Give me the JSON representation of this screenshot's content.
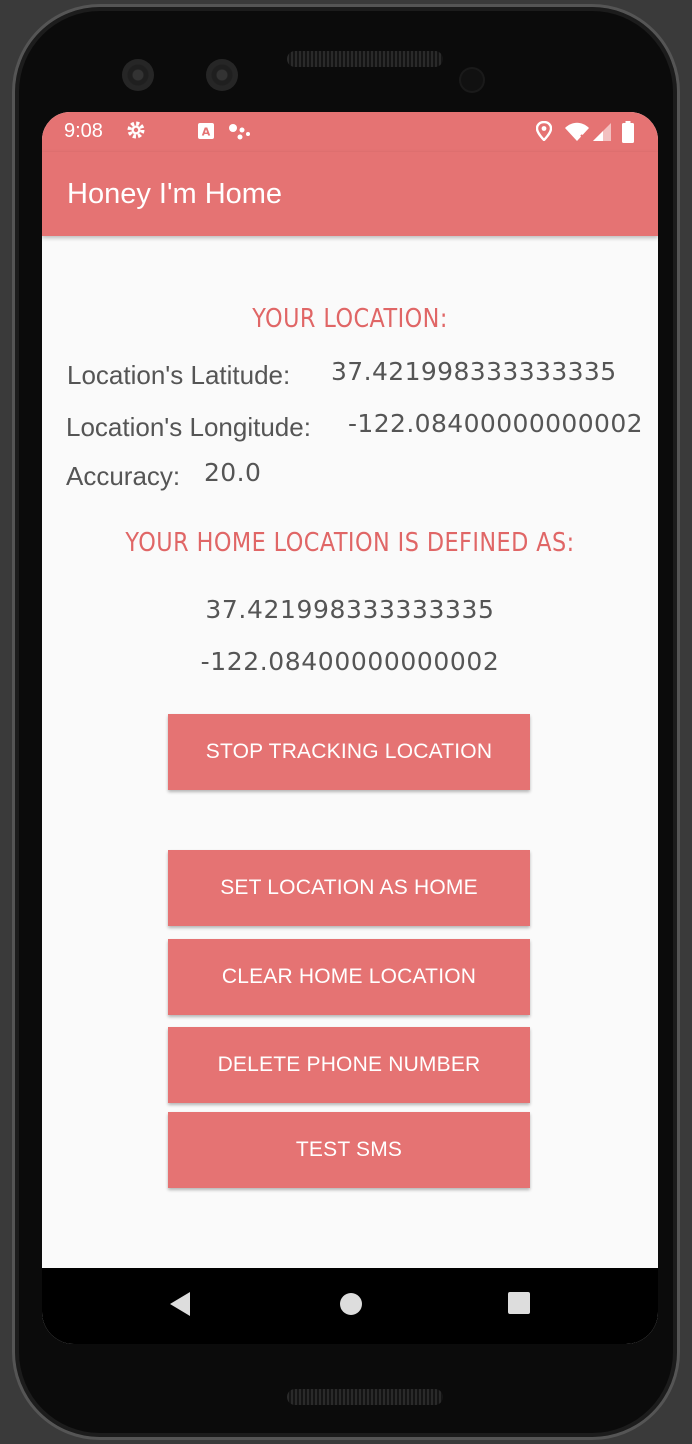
{
  "status_bar": {
    "time": "9:08",
    "icons": [
      "gear-icon",
      "a-notification-icon",
      "assistant-dots-icon",
      "location-pin-icon",
      "wifi-icon",
      "signal-icon",
      "battery-icon"
    ]
  },
  "app_bar": {
    "title": "Honey I'm Home"
  },
  "current_location": {
    "heading": "YOUR LOCATION:",
    "latitude_label": "Location's Latitude:",
    "latitude_value": "37.421998333333335",
    "longitude_label": "Location's Longitude:",
    "longitude_value": "-122.08400000000002",
    "accuracy_label": "Accuracy:",
    "accuracy_value": "20.0"
  },
  "home_location": {
    "heading": "YOUR HOME LOCATION IS DEFINED AS:",
    "latitude": "37.421998333333335",
    "longitude": "-122.08400000000002"
  },
  "buttons": {
    "stop_tracking": "STOP TRACKING LOCATION",
    "set_home": "SET LOCATION AS HOME",
    "clear_home": "CLEAR HOME LOCATION",
    "delete_phone": "DELETE PHONE NUMBER",
    "test_sms": "TEST SMS"
  },
  "nav_bar": {
    "icons": [
      "back-icon",
      "home-icon",
      "recents-icon"
    ]
  },
  "colors": {
    "accent": "#e57373",
    "heading": "#e06666",
    "background": "#fafafa"
  }
}
